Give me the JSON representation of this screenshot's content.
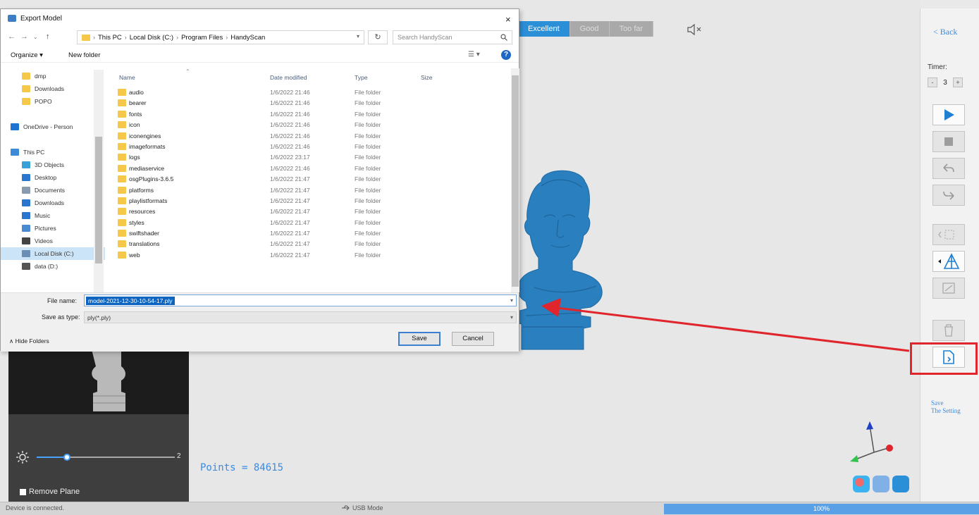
{
  "dialog": {
    "title": "Export Model",
    "close_label": "×",
    "address_crumbs": [
      "This PC",
      "Local Disk (C:)",
      "Program Files",
      "HandyScan"
    ],
    "search_placeholder": "Search HandyScan",
    "organize_label": "Organize ▾",
    "new_folder_label": "New folder",
    "nav_items": [
      {
        "label": "dmp",
        "icon": "folder-icon",
        "color": "#f6c84a"
      },
      {
        "label": "Downloads",
        "icon": "folder-icon",
        "color": "#f6c84a"
      },
      {
        "label": "POPO",
        "icon": "folder-icon",
        "color": "#f6c84a"
      },
      {
        "label": "",
        "icon": "spacer",
        "color": "transparent"
      },
      {
        "label": "OneDrive - Person",
        "icon": "cloud-icon",
        "color": "#1e74d0"
      },
      {
        "label": "",
        "icon": "spacer",
        "color": "transparent"
      },
      {
        "label": "This PC",
        "icon": "computer-icon",
        "color": "#3d8ad8"
      },
      {
        "label": "3D Objects",
        "icon": "cube-icon",
        "color": "#3aa0d8"
      },
      {
        "label": "Desktop",
        "icon": "desktop-icon",
        "color": "#2a76cf"
      },
      {
        "label": "Documents",
        "icon": "document-icon",
        "color": "#8a9bb0"
      },
      {
        "label": "Downloads",
        "icon": "download-icon",
        "color": "#2a76cf"
      },
      {
        "label": "Music",
        "icon": "music-icon",
        "color": "#2a76cf"
      },
      {
        "label": "Pictures",
        "icon": "pictures-icon",
        "color": "#4a8ad0"
      },
      {
        "label": "Videos",
        "icon": "video-icon",
        "color": "#444"
      },
      {
        "label": "Local Disk (C:)",
        "icon": "disk-icon",
        "color": "#6b8fb4",
        "selected": true
      },
      {
        "label": "data (D:)",
        "icon": "disk-icon",
        "color": "#555"
      }
    ],
    "columns": {
      "name": "Name",
      "date": "Date modified",
      "type": "Type",
      "size": "Size"
    },
    "files": [
      {
        "name": "audio",
        "date": "1/6/2022 21:46",
        "type": "File folder"
      },
      {
        "name": "bearer",
        "date": "1/6/2022 21:46",
        "type": "File folder"
      },
      {
        "name": "fonts",
        "date": "1/6/2022 21:46",
        "type": "File folder"
      },
      {
        "name": "icon",
        "date": "1/6/2022 21:46",
        "type": "File folder"
      },
      {
        "name": "iconengines",
        "date": "1/6/2022 21:46",
        "type": "File folder"
      },
      {
        "name": "imageformats",
        "date": "1/6/2022 21:46",
        "type": "File folder"
      },
      {
        "name": "logs",
        "date": "1/6/2022 23:17",
        "type": "File folder"
      },
      {
        "name": "mediaservice",
        "date": "1/6/2022 21:46",
        "type": "File folder"
      },
      {
        "name": "osgPlugins-3.6.5",
        "date": "1/6/2022 21:47",
        "type": "File folder"
      },
      {
        "name": "platforms",
        "date": "1/6/2022 21:47",
        "type": "File folder"
      },
      {
        "name": "playlistformats",
        "date": "1/6/2022 21:47",
        "type": "File folder"
      },
      {
        "name": "resources",
        "date": "1/6/2022 21:47",
        "type": "File folder"
      },
      {
        "name": "styles",
        "date": "1/6/2022 21:47",
        "type": "File folder"
      },
      {
        "name": "swiftshader",
        "date": "1/6/2022 21:47",
        "type": "File folder"
      },
      {
        "name": "translations",
        "date": "1/6/2022 21:47",
        "type": "File folder"
      },
      {
        "name": "web",
        "date": "1/6/2022 21:47",
        "type": "File folder"
      }
    ],
    "file_name_label": "File name:",
    "file_name_value": "model-2021-12-30-10-54-17.ply",
    "save_type_label": "Save as type:",
    "save_type_value": "ply(*.ply)",
    "hide_folders_label": "∧  Hide Folders",
    "save_label": "Save",
    "cancel_label": "Cancel"
  },
  "viewport": {
    "mode_tabs": [
      {
        "label": "Excellent",
        "active": true
      },
      {
        "label": "Good",
        "active": false
      },
      {
        "label": "Too far",
        "active": false
      }
    ],
    "points_label": "Points = 84615",
    "model_color": "#2a7fbe"
  },
  "camera_panel": {
    "brightness_value": "2",
    "brightness_fraction": 0.22,
    "remove_plane_label": "Remove Plane"
  },
  "toolbar": {
    "back_label": "< Back",
    "timer_label": "Timer:",
    "timer_minus": "-",
    "timer_value": "3",
    "timer_plus": "+",
    "save_setting_line1": "Save",
    "save_setting_line2": "The Setting",
    "accent": "#2b8fd8",
    "highlight": "#e0252c"
  },
  "status": {
    "connection": "Device is connected.",
    "usb_mode": "USB Mode",
    "progress_text": "100%",
    "progress_fraction": 1.0
  }
}
